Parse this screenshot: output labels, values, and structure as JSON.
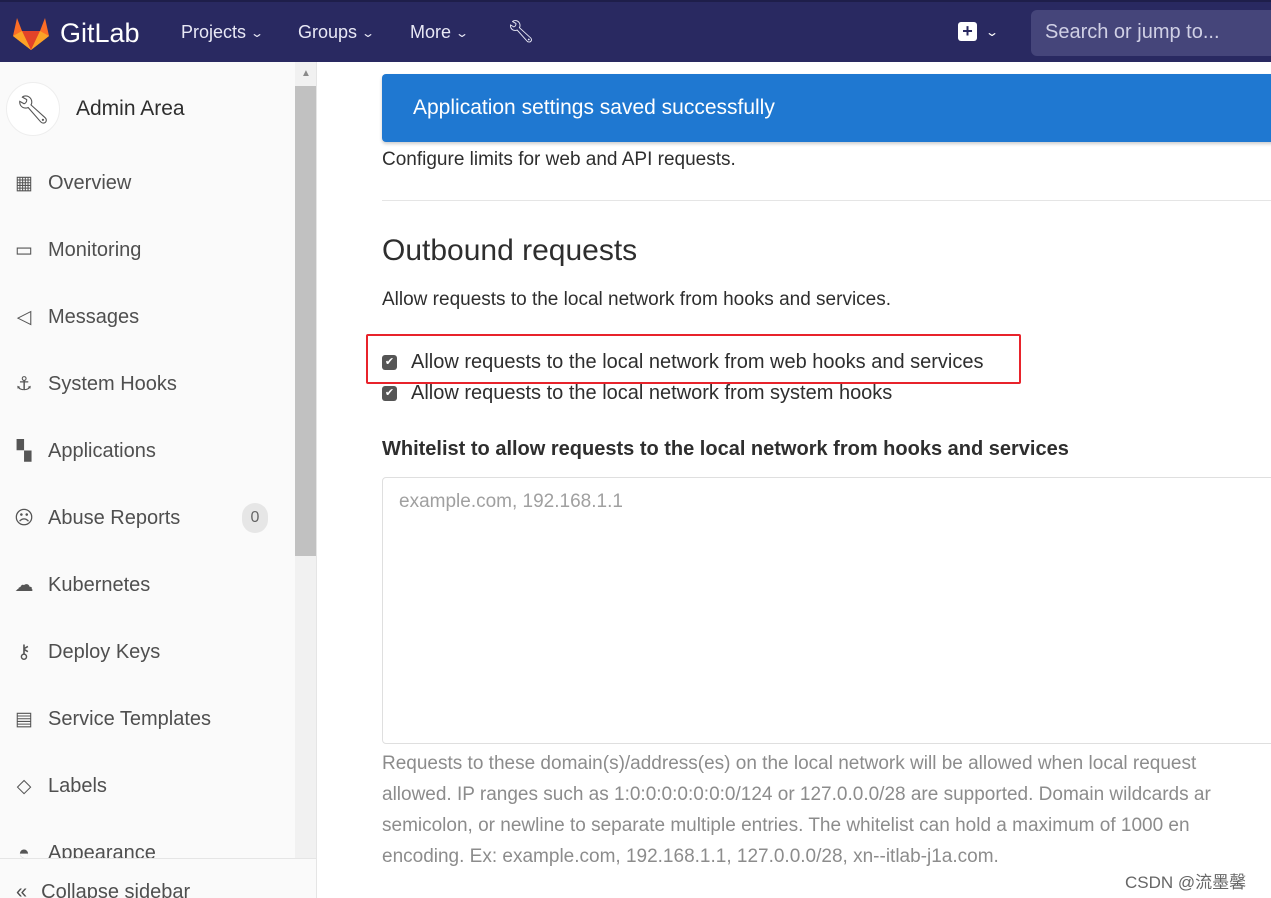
{
  "navbar": {
    "brand": "GitLab",
    "items": [
      "Projects",
      "Groups",
      "More"
    ],
    "search_placeholder": "Search or jump to...",
    "color": "#292961"
  },
  "sidebar": {
    "title": "Admin Area",
    "items": [
      {
        "label": "Overview",
        "icon": "overview-icon"
      },
      {
        "label": "Monitoring",
        "icon": "monitor-icon"
      },
      {
        "label": "Messages",
        "icon": "megaphone-icon"
      },
      {
        "label": "System Hooks",
        "icon": "anchor-icon"
      },
      {
        "label": "Applications",
        "icon": "applications-icon"
      },
      {
        "label": "Abuse Reports",
        "icon": "sad-face-icon",
        "badge": "0"
      },
      {
        "label": "Kubernetes",
        "icon": "kubernetes-icon"
      },
      {
        "label": "Deploy Keys",
        "icon": "key-icon"
      },
      {
        "label": "Service Templates",
        "icon": "template-icon"
      },
      {
        "label": "Labels",
        "icon": "label-icon"
      },
      {
        "label": "Appearance",
        "icon": "palette-icon"
      }
    ],
    "collapse": "Collapse sidebar"
  },
  "flash": {
    "message": "Application settings saved successfully",
    "color": "#1f78d1"
  },
  "main": {
    "limits_desc": "Configure limits for web and API requests.",
    "section_title": "Outbound requests",
    "section_desc": "Allow requests to the local network from hooks and services.",
    "checkboxes": [
      {
        "label": "Allow requests to the local network from web hooks and services",
        "checked": true
      },
      {
        "label": "Allow requests to the local network from system hooks",
        "checked": true
      }
    ],
    "whitelist_label": "Whitelist to allow requests to the local network from hooks and services",
    "whitelist_placeholder": "example.com, 192.168.1.1",
    "whitelist_value": "",
    "help": [
      "Requests to these domain(s)/address(es) on the local network will be allowed when local request",
      "allowed. IP ranges such as 1:0:0:0:0:0:0:0/124 or 127.0.0.0/28 are supported. Domain wildcards ar",
      "semicolon, or newline to separate multiple entries. The whitelist can hold a maximum of 1000 en",
      "encoding. Ex: example.com, 192.168.1.1, 127.0.0.0/28, xn--itlab-j1a.com."
    ]
  },
  "watermark": "CSDN @流墨馨"
}
